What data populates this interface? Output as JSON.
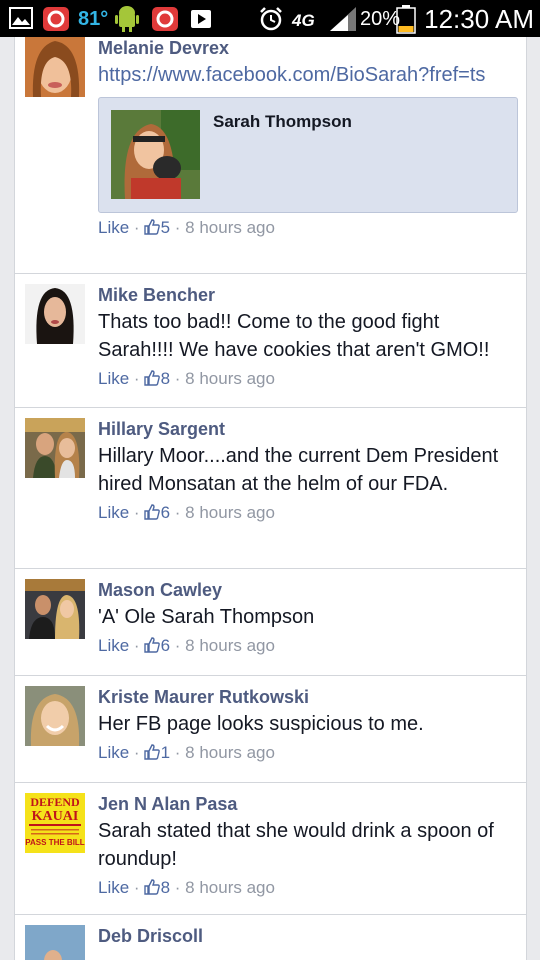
{
  "status_bar": {
    "temperature": "81°",
    "network": "4G",
    "battery": "20%",
    "time": "12:30 AM"
  },
  "icons": [
    "gallery-icon",
    "notification-icon",
    "android-icon",
    "notification-icon",
    "play-store-icon",
    "alarm-icon",
    "signal-icon",
    "battery-icon",
    "thumbs-up-icon"
  ],
  "comments": [
    {
      "name": "Melanie Devrex",
      "link": "https://www.facebook.com/BioSarah?fref=ts",
      "preview_title": "Sarah Thompson",
      "like_label": "Like",
      "likes": "5",
      "time": "8 hours ago"
    },
    {
      "name": "Mike Bencher",
      "text": "Thats too bad!! Come to the good fight Sarah!!!! We have cookies that aren't GMO!!",
      "like_label": "Like",
      "likes": "8",
      "time": "8 hours ago"
    },
    {
      "name": "Hillary Sargent",
      "text": "Hillary Moor....and the current Dem President hired Monsatan at the helm of our FDA.",
      "like_label": "Like",
      "likes": "6",
      "time": "8 hours ago"
    },
    {
      "name": "Mason Cawley",
      "text": "'A' Ole Sarah Thompson",
      "like_label": "Like",
      "likes": "6",
      "time": "8 hours ago"
    },
    {
      "name": "Kriste Maurer Rutkowski",
      "text": "Her FB page looks suspicious to me.",
      "like_label": "Like",
      "likes": "1",
      "time": "8 hours ago"
    },
    {
      "name": "Jen N Alan Pasa",
      "avatar_text": [
        "DEFEND",
        "KAUAI",
        "PASS THE BILL"
      ],
      "text": "Sarah stated that she would drink a spoon of roundup!",
      "like_label": "Like",
      "likes": "8",
      "time": "8 hours ago"
    },
    {
      "name": "Deb Driscoll"
    }
  ]
}
